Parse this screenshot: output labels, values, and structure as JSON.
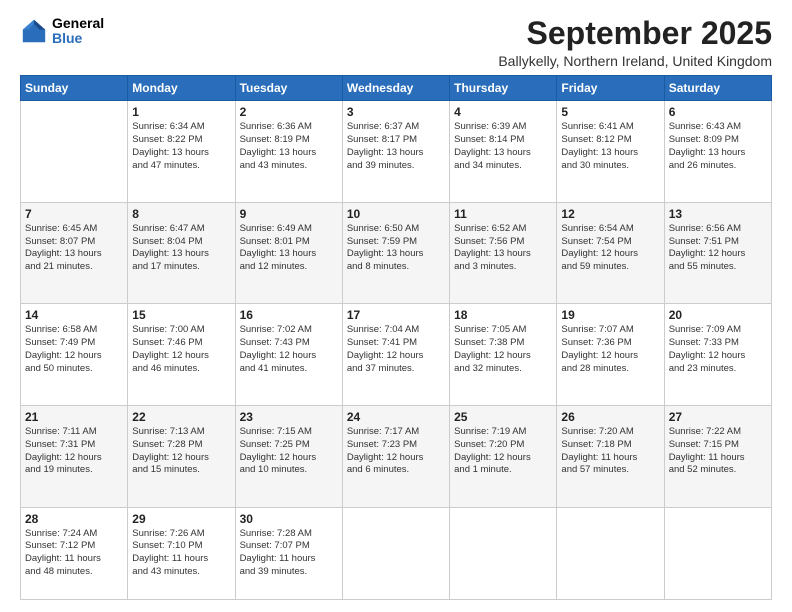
{
  "header": {
    "logo_general": "General",
    "logo_blue": "Blue",
    "month_title": "September 2025",
    "subtitle": "Ballykelly, Northern Ireland, United Kingdom"
  },
  "days_of_week": [
    "Sunday",
    "Monday",
    "Tuesday",
    "Wednesday",
    "Thursday",
    "Friday",
    "Saturday"
  ],
  "weeks": [
    [
      {
        "day": "",
        "info": ""
      },
      {
        "day": "1",
        "info": "Sunrise: 6:34 AM\nSunset: 8:22 PM\nDaylight: 13 hours\nand 47 minutes."
      },
      {
        "day": "2",
        "info": "Sunrise: 6:36 AM\nSunset: 8:19 PM\nDaylight: 13 hours\nand 43 minutes."
      },
      {
        "day": "3",
        "info": "Sunrise: 6:37 AM\nSunset: 8:17 PM\nDaylight: 13 hours\nand 39 minutes."
      },
      {
        "day": "4",
        "info": "Sunrise: 6:39 AM\nSunset: 8:14 PM\nDaylight: 13 hours\nand 34 minutes."
      },
      {
        "day": "5",
        "info": "Sunrise: 6:41 AM\nSunset: 8:12 PM\nDaylight: 13 hours\nand 30 minutes."
      },
      {
        "day": "6",
        "info": "Sunrise: 6:43 AM\nSunset: 8:09 PM\nDaylight: 13 hours\nand 26 minutes."
      }
    ],
    [
      {
        "day": "7",
        "info": "Sunrise: 6:45 AM\nSunset: 8:07 PM\nDaylight: 13 hours\nand 21 minutes."
      },
      {
        "day": "8",
        "info": "Sunrise: 6:47 AM\nSunset: 8:04 PM\nDaylight: 13 hours\nand 17 minutes."
      },
      {
        "day": "9",
        "info": "Sunrise: 6:49 AM\nSunset: 8:01 PM\nDaylight: 13 hours\nand 12 minutes."
      },
      {
        "day": "10",
        "info": "Sunrise: 6:50 AM\nSunset: 7:59 PM\nDaylight: 13 hours\nand 8 minutes."
      },
      {
        "day": "11",
        "info": "Sunrise: 6:52 AM\nSunset: 7:56 PM\nDaylight: 13 hours\nand 3 minutes."
      },
      {
        "day": "12",
        "info": "Sunrise: 6:54 AM\nSunset: 7:54 PM\nDaylight: 12 hours\nand 59 minutes."
      },
      {
        "day": "13",
        "info": "Sunrise: 6:56 AM\nSunset: 7:51 PM\nDaylight: 12 hours\nand 55 minutes."
      }
    ],
    [
      {
        "day": "14",
        "info": "Sunrise: 6:58 AM\nSunset: 7:49 PM\nDaylight: 12 hours\nand 50 minutes."
      },
      {
        "day": "15",
        "info": "Sunrise: 7:00 AM\nSunset: 7:46 PM\nDaylight: 12 hours\nand 46 minutes."
      },
      {
        "day": "16",
        "info": "Sunrise: 7:02 AM\nSunset: 7:43 PM\nDaylight: 12 hours\nand 41 minutes."
      },
      {
        "day": "17",
        "info": "Sunrise: 7:04 AM\nSunset: 7:41 PM\nDaylight: 12 hours\nand 37 minutes."
      },
      {
        "day": "18",
        "info": "Sunrise: 7:05 AM\nSunset: 7:38 PM\nDaylight: 12 hours\nand 32 minutes."
      },
      {
        "day": "19",
        "info": "Sunrise: 7:07 AM\nSunset: 7:36 PM\nDaylight: 12 hours\nand 28 minutes."
      },
      {
        "day": "20",
        "info": "Sunrise: 7:09 AM\nSunset: 7:33 PM\nDaylight: 12 hours\nand 23 minutes."
      }
    ],
    [
      {
        "day": "21",
        "info": "Sunrise: 7:11 AM\nSunset: 7:31 PM\nDaylight: 12 hours\nand 19 minutes."
      },
      {
        "day": "22",
        "info": "Sunrise: 7:13 AM\nSunset: 7:28 PM\nDaylight: 12 hours\nand 15 minutes."
      },
      {
        "day": "23",
        "info": "Sunrise: 7:15 AM\nSunset: 7:25 PM\nDaylight: 12 hours\nand 10 minutes."
      },
      {
        "day": "24",
        "info": "Sunrise: 7:17 AM\nSunset: 7:23 PM\nDaylight: 12 hours\nand 6 minutes."
      },
      {
        "day": "25",
        "info": "Sunrise: 7:19 AM\nSunset: 7:20 PM\nDaylight: 12 hours\nand 1 minute."
      },
      {
        "day": "26",
        "info": "Sunrise: 7:20 AM\nSunset: 7:18 PM\nDaylight: 11 hours\nand 57 minutes."
      },
      {
        "day": "27",
        "info": "Sunrise: 7:22 AM\nSunset: 7:15 PM\nDaylight: 11 hours\nand 52 minutes."
      }
    ],
    [
      {
        "day": "28",
        "info": "Sunrise: 7:24 AM\nSunset: 7:12 PM\nDaylight: 11 hours\nand 48 minutes."
      },
      {
        "day": "29",
        "info": "Sunrise: 7:26 AM\nSunset: 7:10 PM\nDaylight: 11 hours\nand 43 minutes."
      },
      {
        "day": "30",
        "info": "Sunrise: 7:28 AM\nSunset: 7:07 PM\nDaylight: 11 hours\nand 39 minutes."
      },
      {
        "day": "",
        "info": ""
      },
      {
        "day": "",
        "info": ""
      },
      {
        "day": "",
        "info": ""
      },
      {
        "day": "",
        "info": ""
      }
    ]
  ]
}
